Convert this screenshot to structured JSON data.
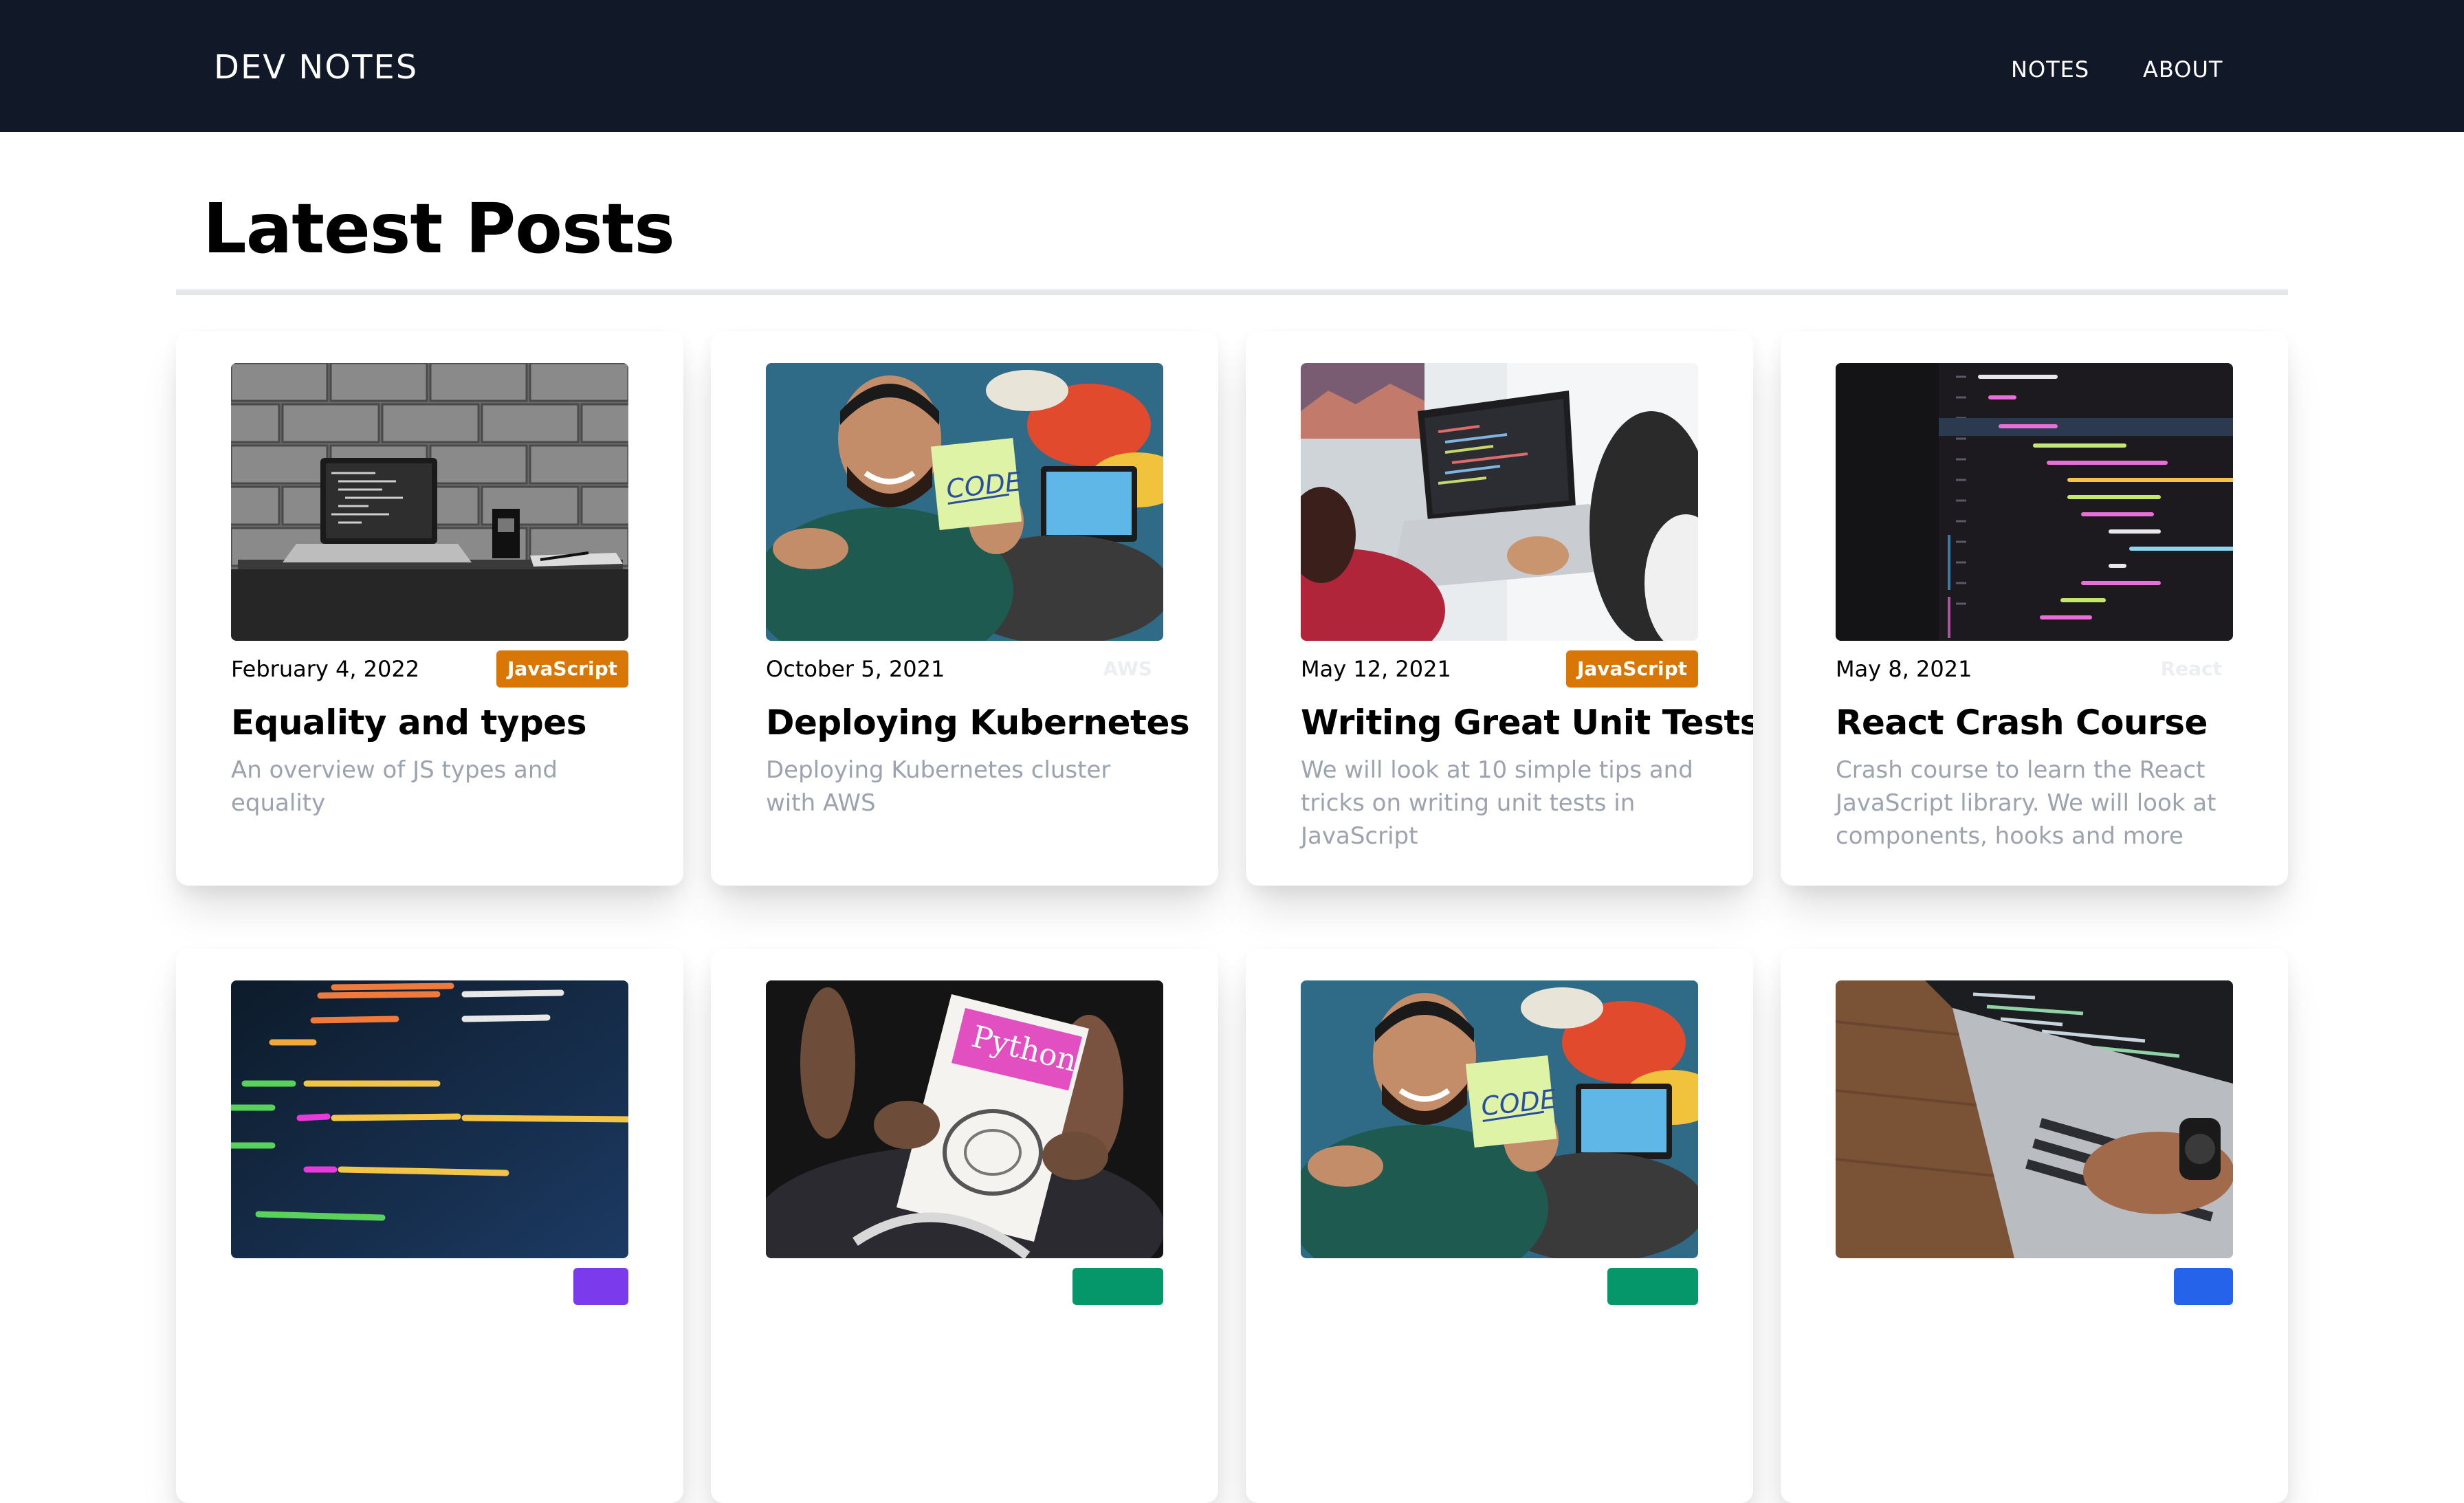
{
  "navbar": {
    "brand": "DEV NOTES",
    "links": [
      "NOTES",
      "ABOUT"
    ]
  },
  "page": {
    "title": "Latest Posts"
  },
  "colors": {
    "navbar_bg": "#111827",
    "javascript_tag": "#d97706",
    "excerpt_text": "#9ca3af",
    "rule": "#e5e7eb"
  },
  "posts": [
    {
      "date": "February 4, 2022",
      "tag": "JavaScript",
      "tag_style": "solid",
      "tag_color": "#d97706",
      "title": "Equality and types",
      "excerpt": "An overview of JS types and equality",
      "image": "grayscale-laptop-brick-wall"
    },
    {
      "date": "October 5, 2021",
      "tag": "AWS",
      "tag_style": "faded",
      "tag_color": "",
      "title": "Deploying Kubernetes",
      "excerpt": "Deploying Kubernetes cluster with AWS",
      "image": "man-holding-code-sticky-note"
    },
    {
      "date": "May 12, 2021",
      "tag": "JavaScript",
      "tag_style": "solid",
      "tag_color": "#d97706",
      "title": "Writing Great Unit Tests",
      "excerpt": "We will look at 10 simple tips and tricks on writing unit tests in JavaScript",
      "image": "people-working-on-laptop"
    },
    {
      "date": "May 8, 2021",
      "tag": "React",
      "tag_style": "faded",
      "tag_color": "",
      "title": "React Crash Course",
      "excerpt": "Crash course to learn the React JavaScript library. We will look at components, hooks and more",
      "image": "react-code-on-screen"
    },
    {
      "date": "",
      "tag": "",
      "tag_style": "solid",
      "tag_color": "#7c3aed",
      "title": "",
      "excerpt": "",
      "image": "php-code-on-screen"
    },
    {
      "date": "",
      "tag": "",
      "tag_style": "solid",
      "tag_color": "#059669",
      "title": "",
      "excerpt": "",
      "image": "python-book-held-in-hands"
    },
    {
      "date": "",
      "tag": "",
      "tag_style": "solid",
      "tag_color": "#059669",
      "title": "",
      "excerpt": "",
      "image": "man-holding-code-sticky-note"
    },
    {
      "date": "",
      "tag": "",
      "tag_style": "solid",
      "tag_color": "#2563eb",
      "title": "",
      "excerpt": "",
      "image": "typing-on-laptop-wooden-desk"
    }
  ]
}
